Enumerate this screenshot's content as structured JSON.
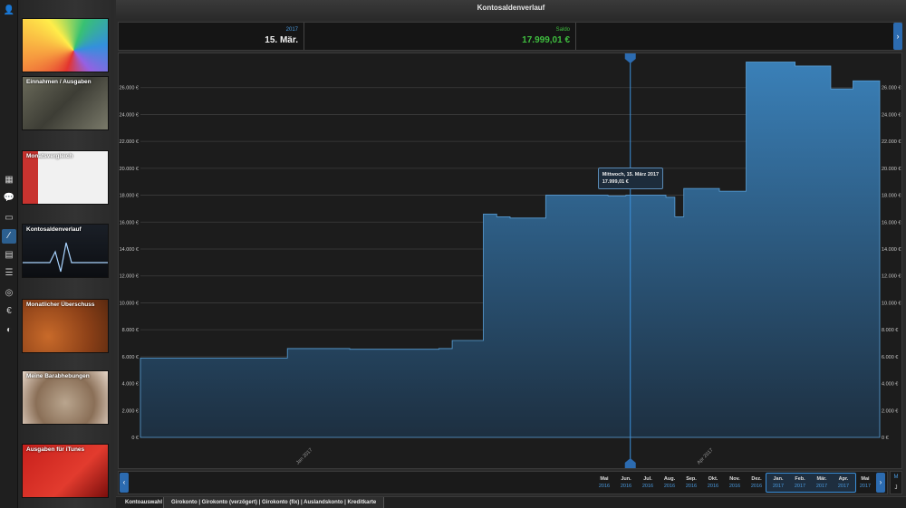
{
  "window": {
    "title": "Kontosaldenverlauf",
    "pager_dots": 2,
    "pager_active": 0
  },
  "rail": {
    "items": [
      {
        "icon": "user-settings-icon",
        "glyph": "👤"
      },
      {
        "icon": "dashboard-icon",
        "glyph": "▦"
      },
      {
        "icon": "chat-icon",
        "glyph": "💬"
      },
      {
        "icon": "storage-icon",
        "glyph": "▭"
      },
      {
        "icon": "line-chart-icon",
        "glyph": "⁄"
      },
      {
        "icon": "cards-icon",
        "glyph": "▤"
      },
      {
        "icon": "list-icon",
        "glyph": "☰"
      },
      {
        "icon": "globe-icon",
        "glyph": "◎"
      },
      {
        "icon": "euro-icon",
        "glyph": "€"
      },
      {
        "icon": "shield-icon",
        "glyph": "◐"
      }
    ],
    "active_index": 4
  },
  "thumbnails": [
    {
      "label": ""
    },
    {
      "label": "Einnahmen / Ausgaben"
    },
    {
      "label": "Monatsvergleich"
    },
    {
      "label": "Kontosaldenverlauf"
    },
    {
      "label": "Monatlicher Überschuss"
    },
    {
      "label": "Meine Barabhebungen"
    },
    {
      "label": "Ausgaben für iTunes"
    }
  ],
  "info_header": {
    "date_year": "2017",
    "date_value": "15. Mär.",
    "saldo_label": "Saldo",
    "saldo_value": "17.999,01 €"
  },
  "tooltip": {
    "line1": "Mittwoch, 15. März 2017",
    "line2": "17.999,01 €"
  },
  "colors": {
    "accent": "#3b8fd9",
    "saldo_green": "#3fbf3f",
    "area_top": "#3a80b8",
    "area_bottom": "#1d2f40"
  },
  "chart_data": {
    "type": "area",
    "title": "",
    "xlabel": "",
    "ylabel": "",
    "ylim": [
      0,
      28000
    ],
    "y_ticks": [
      "0 €",
      "2.000 €",
      "4.000 €",
      "6.000 €",
      "8.000 €",
      "10.000 €",
      "12.000 €",
      "14.000 €",
      "16.000 €",
      "18.000 €",
      "20.000 €",
      "22.000 €",
      "24.000 €",
      "26.000 €"
    ],
    "x_labels": [
      {
        "label": "Jan 2017",
        "date": "2017-01-01"
      },
      {
        "label": "Apr 2017",
        "date": "2017-04-01"
      }
    ],
    "x_range": [
      "2016-11-25",
      "2017-05-10"
    ],
    "grid": true,
    "series": [
      {
        "values": [
          {
            "date": "2016-11-25",
            "y": 5900
          },
          {
            "date": "2016-12-28",
            "y": 6600
          },
          {
            "date": "2017-01-11",
            "y": 6550
          },
          {
            "date": "2017-01-31",
            "y": 6600
          },
          {
            "date": "2017-02-03",
            "y": 7200
          },
          {
            "date": "2017-02-10",
            "y": 16600
          },
          {
            "date": "2017-02-13",
            "y": 16400
          },
          {
            "date": "2017-02-16",
            "y": 16300
          },
          {
            "date": "2017-02-23",
            "y": 16300
          },
          {
            "date": "2017-02-24",
            "y": 17999.01
          },
          {
            "date": "2017-03-10",
            "y": 17950
          },
          {
            "date": "2017-03-14",
            "y": 17999.01
          },
          {
            "date": "2017-03-23",
            "y": 17850
          },
          {
            "date": "2017-03-25",
            "y": 16400
          },
          {
            "date": "2017-03-27",
            "y": 18500
          },
          {
            "date": "2017-04-04",
            "y": 18300
          },
          {
            "date": "2017-04-10",
            "y": 27900
          },
          {
            "date": "2017-04-21",
            "y": 27600
          },
          {
            "date": "2017-04-29",
            "y": 25900
          },
          {
            "date": "2017-05-04",
            "y": 26500
          },
          {
            "date": "2017-05-10",
            "y": 26500
          }
        ]
      }
    ],
    "cursor_date": "2017-03-15"
  },
  "timeline": {
    "months": [
      {
        "m": "Mai",
        "y": "2016"
      },
      {
        "m": "Jun.",
        "y": "2016"
      },
      {
        "m": "Jul.",
        "y": "2016"
      },
      {
        "m": "Aug.",
        "y": "2016"
      },
      {
        "m": "Sep.",
        "y": "2016"
      },
      {
        "m": "Okt.",
        "y": "2016"
      },
      {
        "m": "Nov.",
        "y": "2016"
      },
      {
        "m": "Dez.",
        "y": "2016"
      },
      {
        "m": "Jan.",
        "y": "2017"
      },
      {
        "m": "Feb.",
        "y": "2017"
      },
      {
        "m": "Mär.",
        "y": "2017"
      },
      {
        "m": "Apr.",
        "y": "2017"
      },
      {
        "m": "Mai",
        "y": "2017"
      }
    ],
    "selected_range": [
      8,
      11
    ],
    "mode_month": "M",
    "mode_year": "J"
  },
  "bottom_tabs": {
    "account_selection": "Kontoauswahl",
    "accounts": "Girokonto | Girokonto (verzögert) | Girokonto (fix) | Auslandskonto | Kreditkarte"
  }
}
